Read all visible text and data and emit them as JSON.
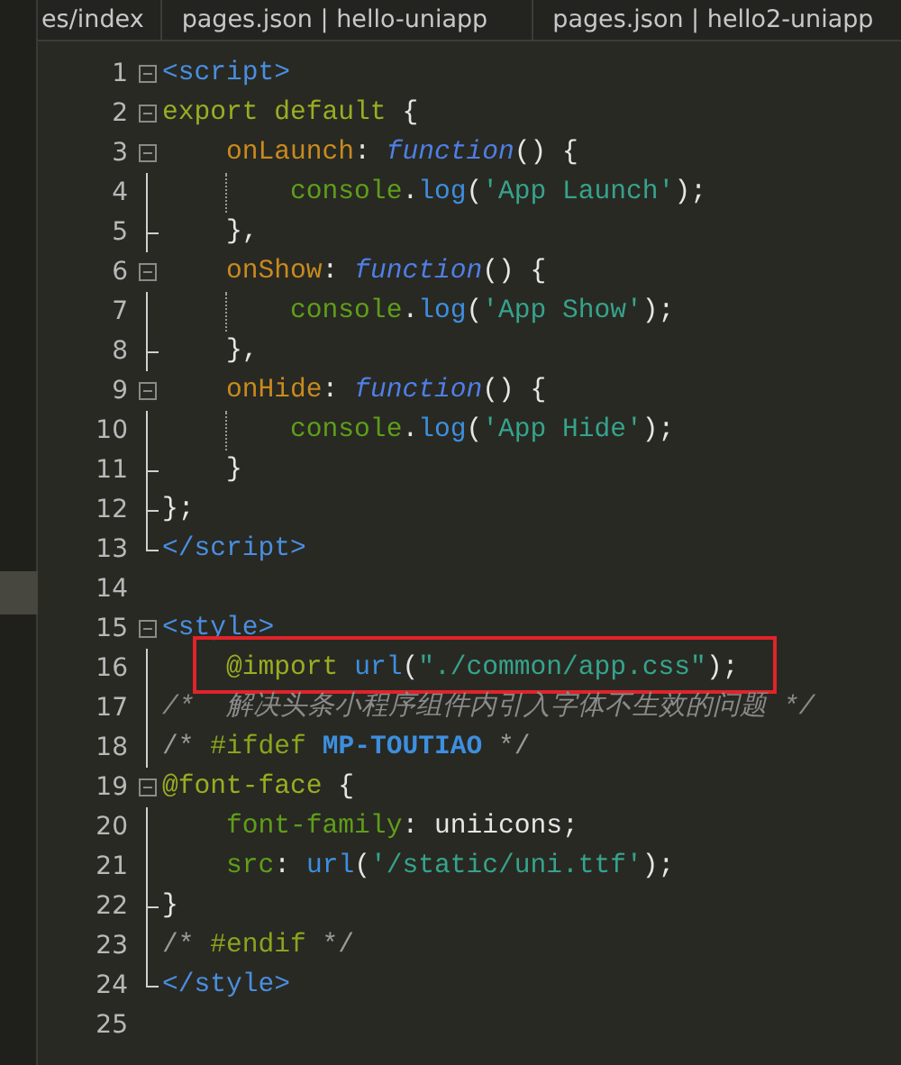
{
  "tabs": [
    {
      "label": "es/index"
    },
    {
      "label": "pages.json | hello-uniapp"
    },
    {
      "label": "pages.json | hello2-uniapp"
    }
  ],
  "lines": [
    {
      "number": "1",
      "kind": "box",
      "tokens": [
        {
          "text": "<script>",
          "kind": "tag"
        }
      ]
    },
    {
      "number": "2",
      "kind": "box",
      "tokens": [
        {
          "text": "export default",
          "kind": "keyword"
        },
        {
          "text": " {",
          "kind": "plain"
        }
      ]
    },
    {
      "number": "3",
      "kind": "box",
      "tokens": [
        {
          "text": "    onLaunch",
          "kind": "property"
        },
        {
          "text": ": ",
          "kind": "plain"
        },
        {
          "text": "function",
          "kind": "function"
        },
        {
          "text": "() {",
          "kind": "plain"
        }
      ]
    },
    {
      "number": "4",
      "kind": "bar",
      "guide": true,
      "tokens": [
        {
          "text": "        console",
          "kind": "builtin"
        },
        {
          "text": ".",
          "kind": "plain"
        },
        {
          "text": "log",
          "kind": "call"
        },
        {
          "text": "(",
          "kind": "plain"
        },
        {
          "text": "'App Launch'",
          "kind": "string"
        },
        {
          "text": ");",
          "kind": "plain"
        }
      ]
    },
    {
      "number": "5",
      "kind": "branch",
      "tokens": [
        {
          "text": "    },",
          "kind": "plain"
        }
      ]
    },
    {
      "number": "6",
      "kind": "box",
      "tokens": [
        {
          "text": "    onShow",
          "kind": "property"
        },
        {
          "text": ": ",
          "kind": "plain"
        },
        {
          "text": "function",
          "kind": "function"
        },
        {
          "text": "() {",
          "kind": "plain"
        }
      ]
    },
    {
      "number": "7",
      "kind": "bar",
      "guide": true,
      "tokens": [
        {
          "text": "        console",
          "kind": "builtin"
        },
        {
          "text": ".",
          "kind": "plain"
        },
        {
          "text": "log",
          "kind": "call"
        },
        {
          "text": "(",
          "kind": "plain"
        },
        {
          "text": "'App Show'",
          "kind": "string"
        },
        {
          "text": ");",
          "kind": "plain"
        }
      ]
    },
    {
      "number": "8",
      "kind": "branch",
      "tokens": [
        {
          "text": "    },",
          "kind": "plain"
        }
      ]
    },
    {
      "number": "9",
      "kind": "box",
      "tokens": [
        {
          "text": "    onHide",
          "kind": "property"
        },
        {
          "text": ": ",
          "kind": "plain"
        },
        {
          "text": "function",
          "kind": "function"
        },
        {
          "text": "() {",
          "kind": "plain"
        }
      ]
    },
    {
      "number": "10",
      "kind": "bar",
      "guide": true,
      "tokens": [
        {
          "text": "        console",
          "kind": "builtin"
        },
        {
          "text": ".",
          "kind": "plain"
        },
        {
          "text": "log",
          "kind": "call"
        },
        {
          "text": "(",
          "kind": "plain"
        },
        {
          "text": "'App Hide'",
          "kind": "string"
        },
        {
          "text": ");",
          "kind": "plain"
        }
      ]
    },
    {
      "number": "11",
      "kind": "branch",
      "tokens": [
        {
          "text": "    }",
          "kind": "plain"
        }
      ]
    },
    {
      "number": "12",
      "kind": "branch",
      "tokens": [
        {
          "text": "};",
          "kind": "plain"
        }
      ]
    },
    {
      "number": "13",
      "kind": "end",
      "tokens": [
        {
          "text": "</script>",
          "kind": "tag"
        }
      ]
    },
    {
      "number": "14",
      "kind": "none"
    },
    {
      "number": "15",
      "kind": "box",
      "tokens": [
        {
          "text": "<style>",
          "kind": "tag"
        }
      ]
    },
    {
      "number": "16",
      "kind": "bar",
      "highlighted": true,
      "tokens": [
        {
          "text": "    @import ",
          "kind": "keyword"
        },
        {
          "text": "url",
          "kind": "call"
        },
        {
          "text": "(",
          "kind": "plain"
        },
        {
          "text": "\"./common/app.css\"",
          "kind": "string"
        },
        {
          "text": ");",
          "kind": "plain"
        }
      ]
    },
    {
      "number": "17",
      "kind": "bar",
      "tokens": [
        {
          "text": "/*  解决头条小程序组件内引入字体不生效的问题 */",
          "kind": "comment"
        }
      ]
    },
    {
      "number": "18",
      "kind": "bar",
      "tokens": [
        {
          "text": "/* ",
          "kind": "comment-plain"
        },
        {
          "text": "#ifdef ",
          "kind": "directive"
        },
        {
          "text": "MP-TOUTIAO",
          "kind": "constant"
        },
        {
          "text": " */",
          "kind": "comment-plain"
        }
      ]
    },
    {
      "number": "19",
      "kind": "box",
      "tokens": [
        {
          "text": "@font-face",
          "kind": "keyword"
        },
        {
          "text": " {",
          "kind": "plain"
        }
      ]
    },
    {
      "number": "20",
      "kind": "bar",
      "tokens": [
        {
          "text": "    font-family",
          "kind": "builtin"
        },
        {
          "text": ": uniicons;",
          "kind": "plain"
        }
      ]
    },
    {
      "number": "21",
      "kind": "bar",
      "tokens": [
        {
          "text": "    src",
          "kind": "builtin"
        },
        {
          "text": ": ",
          "kind": "plain"
        },
        {
          "text": "url",
          "kind": "call"
        },
        {
          "text": "(",
          "kind": "plain"
        },
        {
          "text": "'/static/uni.ttf'",
          "kind": "string"
        },
        {
          "text": ");",
          "kind": "plain"
        }
      ]
    },
    {
      "number": "22",
      "kind": "branch",
      "tokens": [
        {
          "text": "}",
          "kind": "plain"
        }
      ]
    },
    {
      "number": "23",
      "kind": "bar",
      "tokens": [
        {
          "text": "/* ",
          "kind": "comment-plain"
        },
        {
          "text": "#endif",
          "kind": "directive"
        },
        {
          "text": " */",
          "kind": "comment-plain"
        }
      ]
    },
    {
      "number": "24",
      "kind": "end",
      "tokens": [
        {
          "text": "</style>",
          "kind": "tag"
        }
      ]
    },
    {
      "number": "25",
      "kind": "none"
    }
  ]
}
